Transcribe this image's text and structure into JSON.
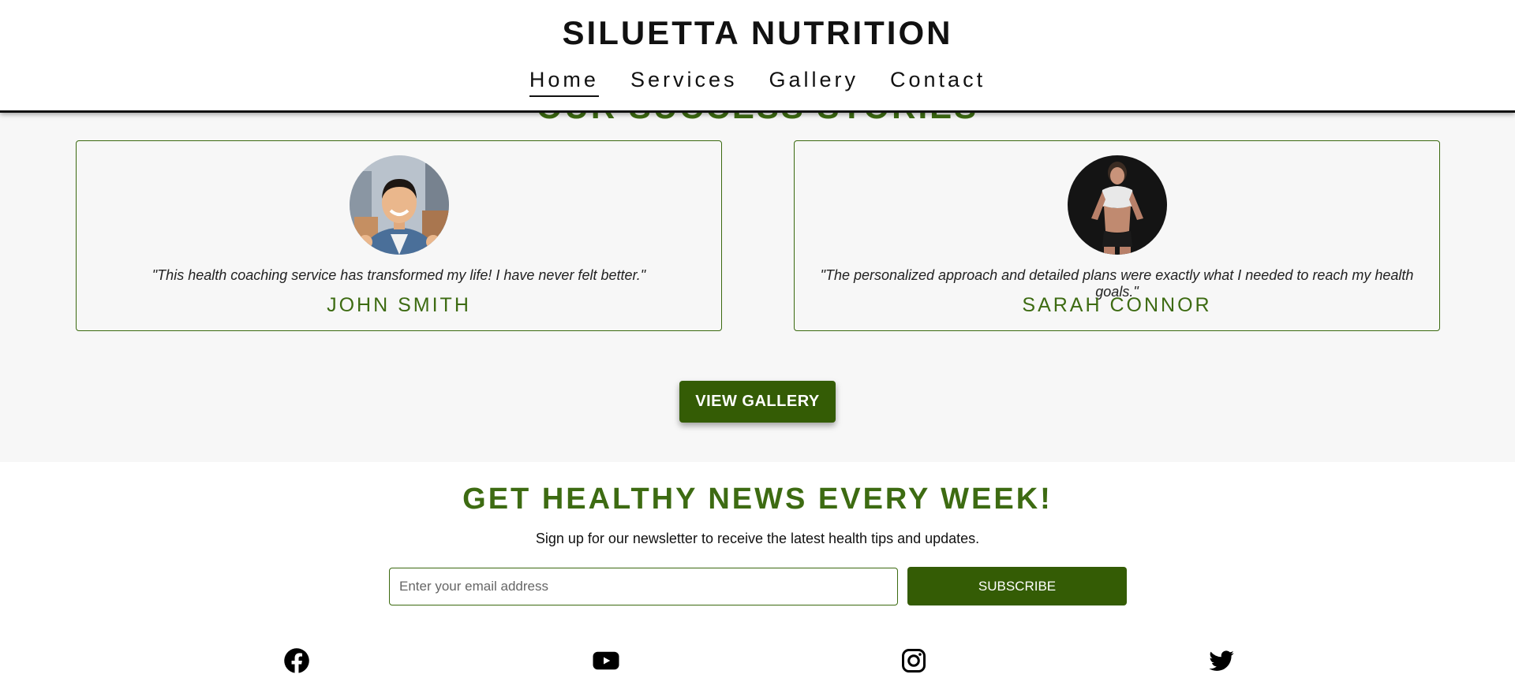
{
  "header": {
    "brand": "SILUETTA NUTRITION",
    "nav": [
      {
        "label": "Home",
        "active": true
      },
      {
        "label": "Services",
        "active": false
      },
      {
        "label": "Gallery",
        "active": false
      },
      {
        "label": "Contact",
        "active": false
      }
    ]
  },
  "stories": {
    "title": "OUR SUCCESS STORIES",
    "items": [
      {
        "quote": "\"This health coaching service has transformed my life! I have never felt better.\"",
        "name": "JOHN SMITH"
      },
      {
        "quote": "\"The personalized approach and detailed plans were exactly what I needed to reach my health goals.\"",
        "name": "SARAH CONNOR"
      }
    ],
    "button_label": "VIEW GALLERY"
  },
  "newsletter": {
    "title": "GET HEALTHY NEWS EVERY WEEK!",
    "subtitle": "Sign up for our newsletter to receive the latest health tips and updates.",
    "placeholder": "Enter your email address",
    "button_label": "SUBSCRIBE"
  },
  "social": [
    "facebook-icon",
    "youtube-icon",
    "instagram-icon",
    "twitter-icon"
  ],
  "colors": {
    "accent": "#3d6b12",
    "button": "#345c05",
    "section_bg": "#f7f7f7"
  }
}
